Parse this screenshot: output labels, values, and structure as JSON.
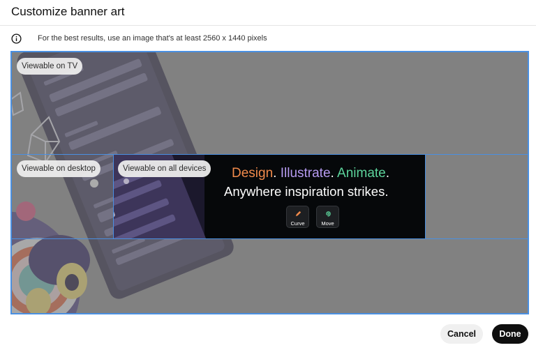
{
  "dialog": {
    "title": "Customize banner art",
    "info_text": "For the best results, use an image that's at least 2560 x 1440 pixels",
    "info_icon": "info-icon"
  },
  "editor": {
    "labels": {
      "tv": "Viewable on TV",
      "desktop": "Viewable on desktop",
      "all_devices": "Viewable on all devices"
    },
    "banner": {
      "headline_part1": "Design",
      "headline_part2": "Illustrate",
      "headline_part3": "Animate",
      "headline_punct": ".",
      "subline": "Anywhere inspiration strikes.",
      "tools": [
        {
          "label": "Curve",
          "icon": "pen-icon"
        },
        {
          "label": "Move",
          "icon": "spiral-icon"
        }
      ],
      "colors": {
        "design": "#f08a4b",
        "illustrate": "#b69bf1",
        "animate": "#5cd39b"
      }
    },
    "frame_color": "#4a90e2"
  },
  "footer": {
    "cancel_label": "Cancel",
    "done_label": "Done"
  }
}
